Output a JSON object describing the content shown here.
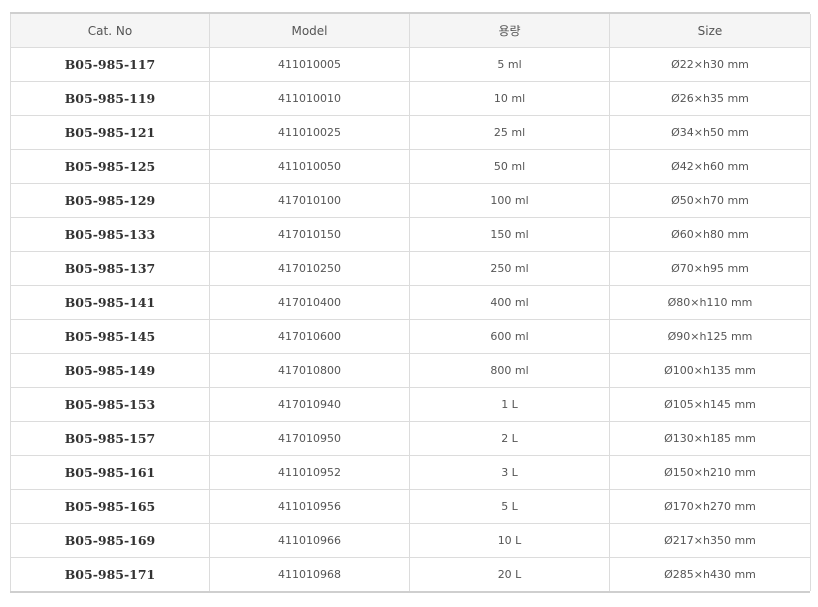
{
  "table": {
    "headers": [
      "Cat. No",
      "Model",
      "용량",
      "Size"
    ],
    "rows": [
      {
        "cat": "B05-985-117",
        "model": "411010005",
        "capacity": "5 ml",
        "size": "Ø22×h30 mm"
      },
      {
        "cat": "B05-985-119",
        "model": "411010010",
        "capacity": "10 ml",
        "size": "Ø26×h35 mm"
      },
      {
        "cat": "B05-985-121",
        "model": "411010025",
        "capacity": "25 ml",
        "size": "Ø34×h50 mm"
      },
      {
        "cat": "B05-985-125",
        "model": "411010050",
        "capacity": "50 ml",
        "size": "Ø42×h60 mm"
      },
      {
        "cat": "B05-985-129",
        "model": "417010100",
        "capacity": "100 ml",
        "size": "Ø50×h70 mm"
      },
      {
        "cat": "B05-985-133",
        "model": "417010150",
        "capacity": "150 ml",
        "size": "Ø60×h80 mm"
      },
      {
        "cat": "B05-985-137",
        "model": "417010250",
        "capacity": "250 ml",
        "size": "Ø70×h95 mm"
      },
      {
        "cat": "B05-985-141",
        "model": "417010400",
        "capacity": "400 ml",
        "size": "Ø80×h110 mm"
      },
      {
        "cat": "B05-985-145",
        "model": "417010600",
        "capacity": "600 ml",
        "size": "Ø90×h125 mm"
      },
      {
        "cat": "B05-985-149",
        "model": "417010800",
        "capacity": "800 ml",
        "size": "Ø100×h135 mm"
      },
      {
        "cat": "B05-985-153",
        "model": "417010940",
        "capacity": "1 L",
        "size": "Ø105×h145 mm"
      },
      {
        "cat": "B05-985-157",
        "model": "417010950",
        "capacity": "2 L",
        "size": "Ø130×h185 mm"
      },
      {
        "cat": "B05-985-161",
        "model": "411010952",
        "capacity": "3 L",
        "size": "Ø150×h210 mm"
      },
      {
        "cat": "B05-985-165",
        "model": "411010956",
        "capacity": "5 L",
        "size": "Ø170×h270 mm"
      },
      {
        "cat": "B05-985-169",
        "model": "411010966",
        "capacity": "10 L",
        "size": "Ø217×h350 mm"
      },
      {
        "cat": "B05-985-171",
        "model": "411010968",
        "capacity": "20 L",
        "size": "Ø285×h430 mm"
      }
    ]
  }
}
